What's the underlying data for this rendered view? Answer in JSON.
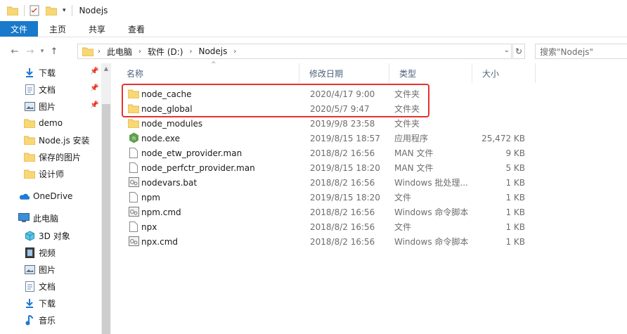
{
  "window": {
    "title": "Nodejs"
  },
  "ribbon": {
    "tabs": [
      "文件",
      "主页",
      "共享",
      "查看"
    ]
  },
  "address": {
    "crumbs": [
      "此电脑",
      "软件 (D:)",
      "Nodejs"
    ],
    "search_placeholder": "搜索\"Nodejs\""
  },
  "nav": {
    "quick_access": [
      {
        "label": "下载",
        "icon": "download-icon",
        "pinned": true
      },
      {
        "label": "文档",
        "icon": "document-icon",
        "pinned": true
      },
      {
        "label": "图片",
        "icon": "picture-icon",
        "pinned": true
      },
      {
        "label": "demo",
        "icon": "folder-icon",
        "pinned": false
      },
      {
        "label": "Node.js 安装",
        "icon": "folder-icon",
        "pinned": false
      },
      {
        "label": "保存的图片",
        "icon": "folder-icon",
        "pinned": false
      },
      {
        "label": "设计师",
        "icon": "folder-icon",
        "pinned": false
      }
    ],
    "onedrive": "OneDrive",
    "this_pc": "此电脑",
    "pc_items": [
      {
        "label": "3D 对象",
        "icon": "cube-icon"
      },
      {
        "label": "视频",
        "icon": "video-icon"
      },
      {
        "label": "图片",
        "icon": "picture-icon"
      },
      {
        "label": "文档",
        "icon": "document-icon"
      },
      {
        "label": "下载",
        "icon": "download-icon"
      },
      {
        "label": "音乐",
        "icon": "music-icon"
      }
    ]
  },
  "columns": {
    "name": "名称",
    "date": "修改日期",
    "type": "类型",
    "size": "大小"
  },
  "files": [
    {
      "name": "node_cache",
      "date": "2020/4/17 9:00",
      "type": "文件夹",
      "size": "",
      "icon": "folder-icon"
    },
    {
      "name": "node_global",
      "date": "2020/5/7 9:47",
      "type": "文件夹",
      "size": "",
      "icon": "folder-icon"
    },
    {
      "name": "node_modules",
      "date": "2019/9/8 23:58",
      "type": "文件夹",
      "size": "",
      "icon": "folder-icon"
    },
    {
      "name": "node.exe",
      "date": "2019/8/15 18:57",
      "type": "应用程序",
      "size": "25,472 KB",
      "icon": "node-exe-icon"
    },
    {
      "name": "node_etw_provider.man",
      "date": "2018/8/2 16:56",
      "type": "MAN 文件",
      "size": "9 KB",
      "icon": "file-icon"
    },
    {
      "name": "node_perfctr_provider.man",
      "date": "2019/8/15 18:20",
      "type": "MAN 文件",
      "size": "5 KB",
      "icon": "file-icon"
    },
    {
      "name": "nodevars.bat",
      "date": "2018/8/2 16:56",
      "type": "Windows 批处理...",
      "size": "1 KB",
      "icon": "batch-file-icon"
    },
    {
      "name": "npm",
      "date": "2019/8/15 18:20",
      "type": "文件",
      "size": "1 KB",
      "icon": "file-icon"
    },
    {
      "name": "npm.cmd",
      "date": "2018/8/2 16:56",
      "type": "Windows 命令脚本",
      "size": "1 KB",
      "icon": "batch-file-icon"
    },
    {
      "name": "npx",
      "date": "2018/8/2 16:56",
      "type": "文件",
      "size": "1 KB",
      "icon": "file-icon"
    },
    {
      "name": "npx.cmd",
      "date": "2018/8/2 16:56",
      "type": "Windows 命令脚本",
      "size": "1 KB",
      "icon": "batch-file-icon"
    }
  ],
  "colors": {
    "accent": "#1979ca",
    "highlight_box": "#e8312c",
    "folder": "#f8d775"
  }
}
